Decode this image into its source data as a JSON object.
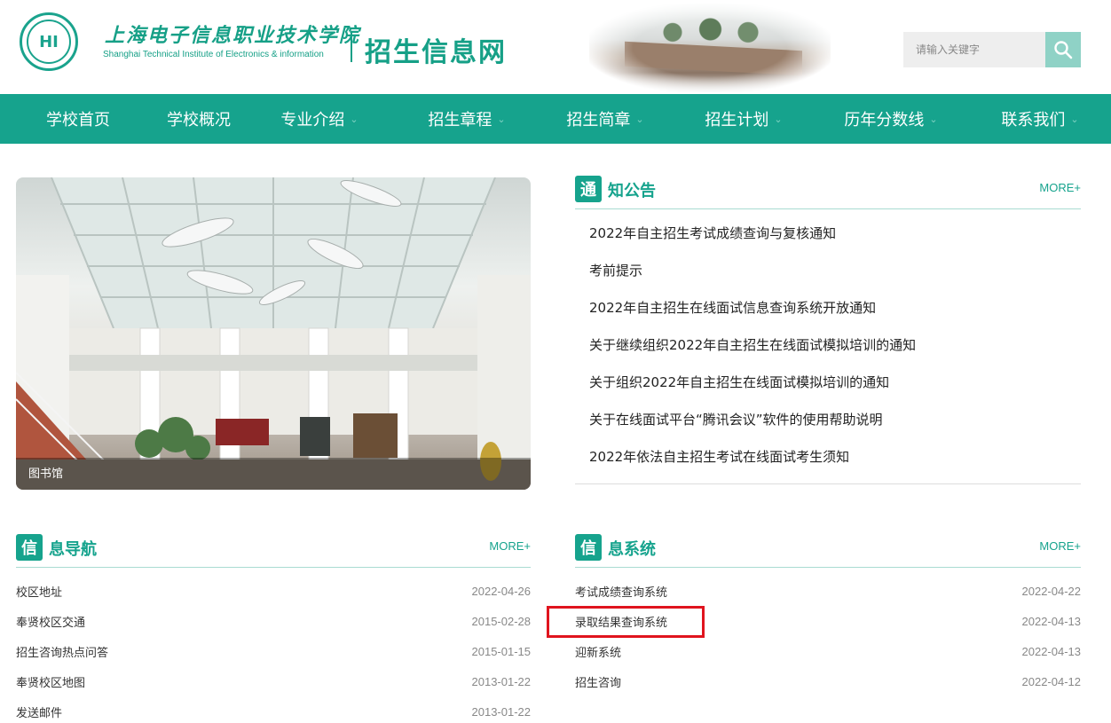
{
  "header": {
    "logo_text": "HI",
    "school_name_cn": "上海电子信息职业技术学院",
    "school_name_en": "Shanghai Technical Institute of Electronics & information",
    "site_title": "招生信息网",
    "search_placeholder": "请输入关键字"
  },
  "nav": {
    "items": [
      {
        "label": "学校首页",
        "has_dropdown": false
      },
      {
        "label": "学校概况",
        "has_dropdown": false
      },
      {
        "label": "专业介绍",
        "has_dropdown": true
      },
      {
        "label": "招生章程",
        "has_dropdown": true
      },
      {
        "label": "招生简章",
        "has_dropdown": true
      },
      {
        "label": "招生计划",
        "has_dropdown": true
      },
      {
        "label": "历年分数线",
        "has_dropdown": true
      },
      {
        "label": "联系我们",
        "has_dropdown": true
      }
    ],
    "chevron": "⌄"
  },
  "slide": {
    "caption": "图书馆"
  },
  "notices": {
    "badge": "通",
    "title_rest": "知公告",
    "more": "MORE+",
    "items": [
      "2022年自主招生考试成绩查询与复核通知",
      "考前提示",
      "2022年自主招生在线面试信息查询系统开放通知",
      "关于继续组织2022年自主招生在线面试模拟培训的通知",
      "关于组织2022年自主招生在线面试模拟培训的通知",
      "关于在线面试平台“腾讯会议”软件的使用帮助说明",
      "2022年依法自主招生考试在线面试考生须知"
    ]
  },
  "info_nav": {
    "badge": "信",
    "title_rest": "息导航",
    "more": "MORE+",
    "items": [
      {
        "title": "校区地址",
        "date": "2022-04-26"
      },
      {
        "title": "奉贤校区交通",
        "date": "2015-02-28"
      },
      {
        "title": "招生咨询热点问答",
        "date": "2015-01-15"
      },
      {
        "title": "奉贤校区地图",
        "date": "2013-01-22"
      },
      {
        "title": "发送邮件",
        "date": "2013-01-22"
      }
    ]
  },
  "info_sys": {
    "badge": "信",
    "title_rest": "息系统",
    "more": "MORE+",
    "items": [
      {
        "title": "考试成绩查询系统",
        "date": "2022-04-22"
      },
      {
        "title": "录取结果查询系统",
        "date": "2022-04-13"
      },
      {
        "title": "迎新系统",
        "date": "2022-04-13"
      },
      {
        "title": "招生咨询",
        "date": "2022-04-12"
      }
    ]
  },
  "colors": {
    "brand": "#16a38d",
    "highlight": "#e0141e"
  }
}
